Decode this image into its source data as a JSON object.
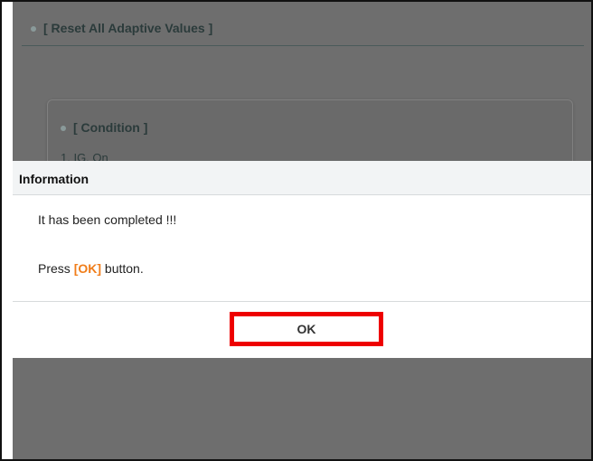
{
  "background": {
    "section_title": "[ Reset All Adaptive Values ]",
    "condition_title": "[ Condition ]",
    "condition_item": "1. IG. On"
  },
  "dialog": {
    "title": "Information",
    "message_line1": "It has been completed !!!",
    "message_prefix": "Press ",
    "message_highlight": "[OK]",
    "message_suffix": " button.",
    "ok_label": "OK"
  },
  "colors": {
    "overlay": "#6e6e6e",
    "highlight": "#f07d1a",
    "button_outline": "#ee0000"
  }
}
